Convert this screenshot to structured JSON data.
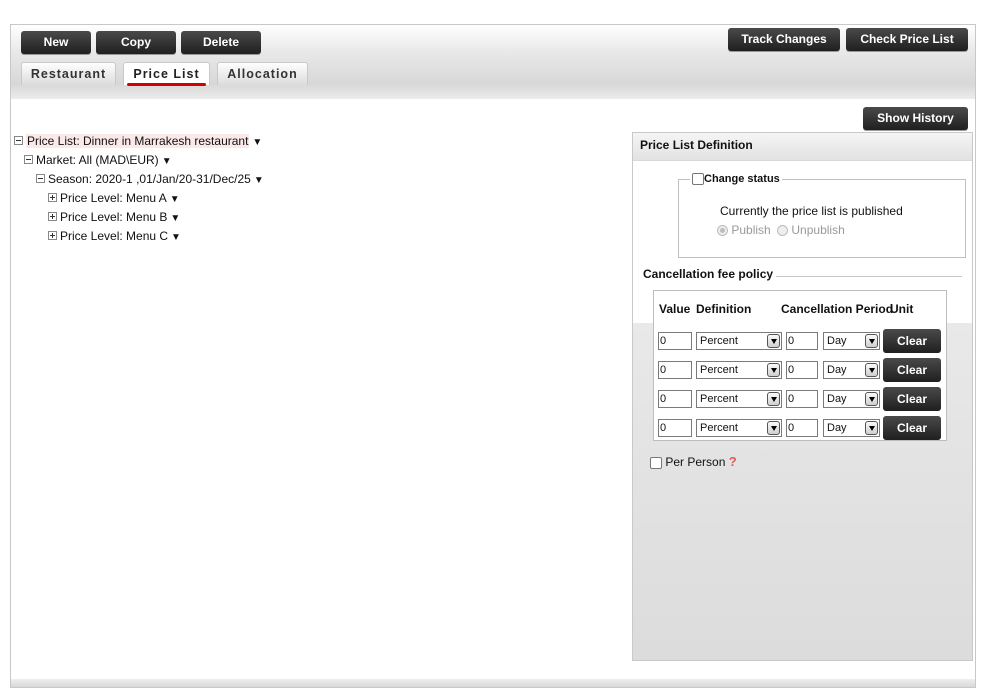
{
  "toolbar": {
    "new_label": "New",
    "copy_label": "Copy",
    "delete_label": "Delete",
    "track_changes_label": "Track Changes",
    "check_price_list_label": "Check Price List",
    "show_history_label": "Show History"
  },
  "tabs": [
    {
      "label": "Restaurant",
      "active": false
    },
    {
      "label": "Price List",
      "active": true
    },
    {
      "label": "Allocation",
      "active": false
    }
  ],
  "tree": {
    "root": "Price List: Dinner in Marrakesh restaurant",
    "market": "Market: All (MAD\\EUR)",
    "season": "Season: 2020-1 ,01/Jan/20-31/Dec/25",
    "levels": [
      "Price Level: Menu A",
      "Price Level: Menu B",
      "Price Level: Menu C"
    ],
    "menu_glyph": "▼"
  },
  "panel": {
    "title": "Price List Definition",
    "change_status": {
      "legend": "Change status",
      "checked": false,
      "message": "Currently the price list is published",
      "options": [
        {
          "label": "Publish",
          "selected": true
        },
        {
          "label": "Unpublish",
          "selected": false
        }
      ]
    },
    "cancellation": {
      "title": "Cancellation fee policy",
      "headers": {
        "value": "Value",
        "definition": "Definition",
        "cancellation_period": "Cancellation Period",
        "unit": "Unit"
      },
      "rows": [
        {
          "value": "0",
          "definition": "Percent",
          "period": "0",
          "unit": "Day",
          "clear": "Clear"
        },
        {
          "value": "0",
          "definition": "Percent",
          "period": "0",
          "unit": "Day",
          "clear": "Clear"
        },
        {
          "value": "0",
          "definition": "Percent",
          "period": "0",
          "unit": "Day",
          "clear": "Clear"
        },
        {
          "value": "0",
          "definition": "Percent",
          "period": "0",
          "unit": "Day",
          "clear": "Clear"
        }
      ],
      "per_person_label": "Per Person",
      "per_person_checked": false,
      "help_glyph": "?"
    }
  },
  "colors": {
    "button_dark": "#2a2a2a",
    "tab_underline": "#d40000",
    "help_icon": "#e05a5a"
  }
}
